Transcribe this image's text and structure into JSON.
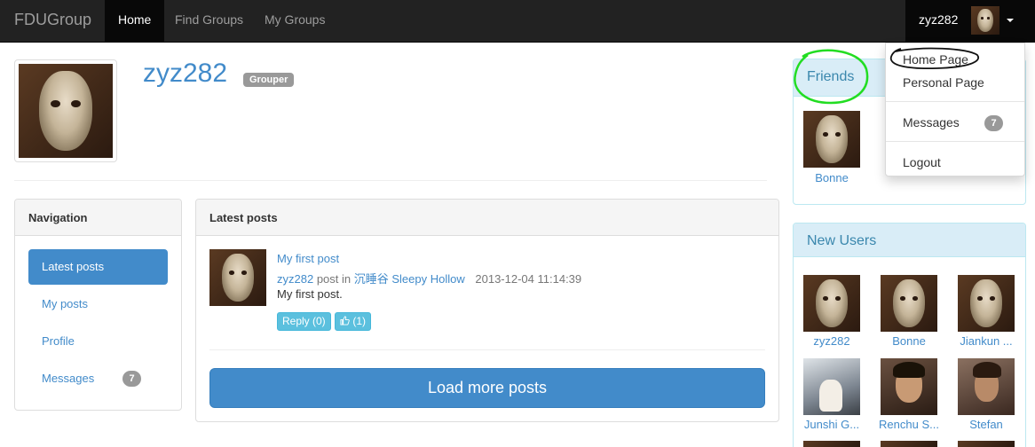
{
  "navbar": {
    "brand": "FDUGroup",
    "items": [
      {
        "label": "Home",
        "active": true
      },
      {
        "label": "Find Groups",
        "active": false
      },
      {
        "label": "My Groups",
        "active": false
      }
    ],
    "user": {
      "name": "zyz282",
      "avatar": "mask-avatar"
    }
  },
  "profile": {
    "name": "zyz282",
    "role_label": "Grouper"
  },
  "navigation": {
    "title": "Navigation",
    "items": [
      {
        "label": "Latest posts",
        "active": true
      },
      {
        "label": "My posts"
      },
      {
        "label": "Profile"
      },
      {
        "label": "Messages",
        "badge": "7"
      }
    ]
  },
  "latest_posts": {
    "title": "Latest posts",
    "posts": [
      {
        "title": "My first post",
        "author": "zyz282",
        "post_in_text": "post in",
        "group": "沉睡谷 Sleepy Hollow",
        "timestamp": "2013-12-04 11:14:39",
        "body": "My first post.",
        "reply_label": "Reply (0)",
        "like_label": "(1)"
      }
    ],
    "load_more_label": "Load more posts"
  },
  "friends": {
    "title": "Friends",
    "items": [
      {
        "name": "Bonne"
      }
    ]
  },
  "new_users": {
    "title": "New Users",
    "items": [
      {
        "name": "zyz282"
      },
      {
        "name": "Bonne"
      },
      {
        "name": "Jiankun ..."
      },
      {
        "name": "Junshi G..."
      },
      {
        "name": "Renchu S..."
      },
      {
        "name": "Stefan"
      }
    ]
  },
  "user_menu": {
    "items": [
      {
        "label": "Home Page"
      },
      {
        "label": "Personal Page"
      },
      {
        "label": "Messages",
        "badge": "7"
      },
      {
        "label": "Logout"
      }
    ]
  },
  "colors": {
    "navbar_bg": "#222222",
    "primary": "#428bca",
    "info": "#5bc0de",
    "annotation_green": "#22dd22"
  }
}
